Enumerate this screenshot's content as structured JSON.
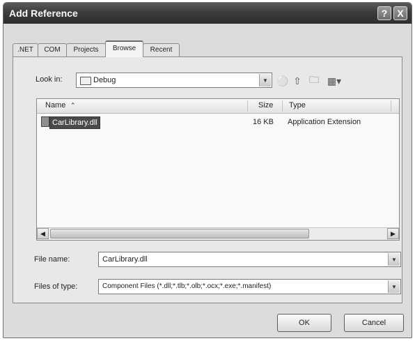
{
  "window": {
    "title": "Add Reference",
    "help_label": "?",
    "close_label": "X"
  },
  "tabs": [
    {
      "label": ".NET"
    },
    {
      "label": "COM"
    },
    {
      "label": "Projects"
    },
    {
      "label": "Browse"
    },
    {
      "label": "Recent"
    }
  ],
  "active_tab": "Browse",
  "look_in": {
    "label": "Look in:",
    "value": "Debug"
  },
  "toolbar": {
    "back_icon": "back-icon",
    "up_icon": "up-folder-icon",
    "new_folder_icon": "new-folder-icon",
    "views_icon": "views-icon"
  },
  "file_list": {
    "columns": [
      "Name",
      "Size",
      "Type"
    ],
    "rows": [
      {
        "name": "CarLibrary.dll",
        "size": "16 KB",
        "type": "Application Extension",
        "selected": true
      }
    ]
  },
  "file_name": {
    "label": "File name:",
    "value": "CarLibrary.dll"
  },
  "files_of_type": {
    "label": "Files of type:",
    "value": "Component Files (*.dll;*.tlb;*.olb;*.ocx;*.exe;*.manifest)"
  },
  "buttons": {
    "ok": "OK",
    "cancel": "Cancel"
  }
}
